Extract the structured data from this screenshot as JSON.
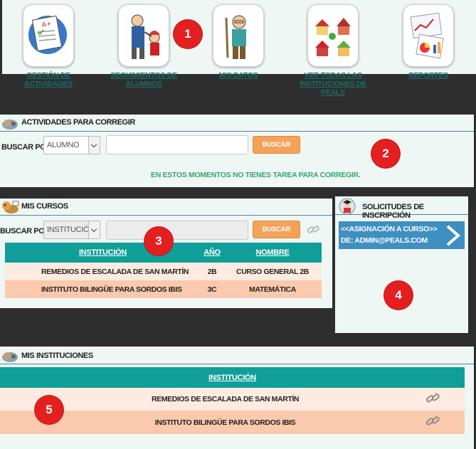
{
  "nav": [
    {
      "label": "GESTIÓN DE ACTIVIDADES",
      "icon": "clipboard-icon"
    },
    {
      "label": "SEGUIMIENTOS DE ALUMNOS",
      "icon": "teacher-student-icon"
    },
    {
      "label": "MIS DATOS",
      "icon": "teacher-icon"
    },
    {
      "label": "VER TODAS LAS INSTITUCIONES DE PEALS",
      "icon": "schools-icon"
    },
    {
      "label": "REPORTES",
      "icon": "charts-icon"
    }
  ],
  "badges": [
    "1",
    "2",
    "3",
    "4",
    "5"
  ],
  "activities": {
    "title": "ACTIVIDADES PARA CORREGIR",
    "search_label": "BUSCAR POR",
    "select_value": "ALUMNO",
    "search_button": "BUSCAR",
    "empty_message": "EN ESTOS MOMENTOS NO TIENES TAREA PARA CORREGIR."
  },
  "courses": {
    "title": "MIS CURSOS",
    "search_label": "BUSCAR POR",
    "select_value": "INSTITUCIÓN",
    "search_button": "BUSCAR",
    "columns": [
      "INSTITUCIÓN",
      "AÑO",
      "NOMBRE"
    ],
    "rows": [
      [
        "REMEDIOS DE ESCALADA DE SAN MARTÍN",
        "2B",
        "CURSO GENERAL 2B"
      ],
      [
        "INSTITUTO BILINGÜE PARA SORDOS IBIS",
        "3C",
        "MATEMÁTICA"
      ]
    ]
  },
  "requests": {
    "title": "SOLICITUDES DE INSCRIPCIÓN",
    "item_line1": "<<ASIGNACIÓN A CURSO>>",
    "item_line2": "DE: ADMIN@PEALS.COM",
    "item_color": "#3f8fc1"
  },
  "institutions": {
    "title": "MIS INSTITUCIONES",
    "column": "INSTITUCIÓN",
    "rows": [
      "REMEDIOS DE ESCALADA DE SAN MARTÍN",
      "INSTITUTO BILINGÜE PARA SORDOS IBIS"
    ]
  },
  "colors": {
    "teal": "#0f9e98",
    "orange_button": "#f4a25a",
    "row_light": "#fdebe2",
    "row_dark": "#fbc9ad",
    "badge_red": "#e41f1f"
  }
}
